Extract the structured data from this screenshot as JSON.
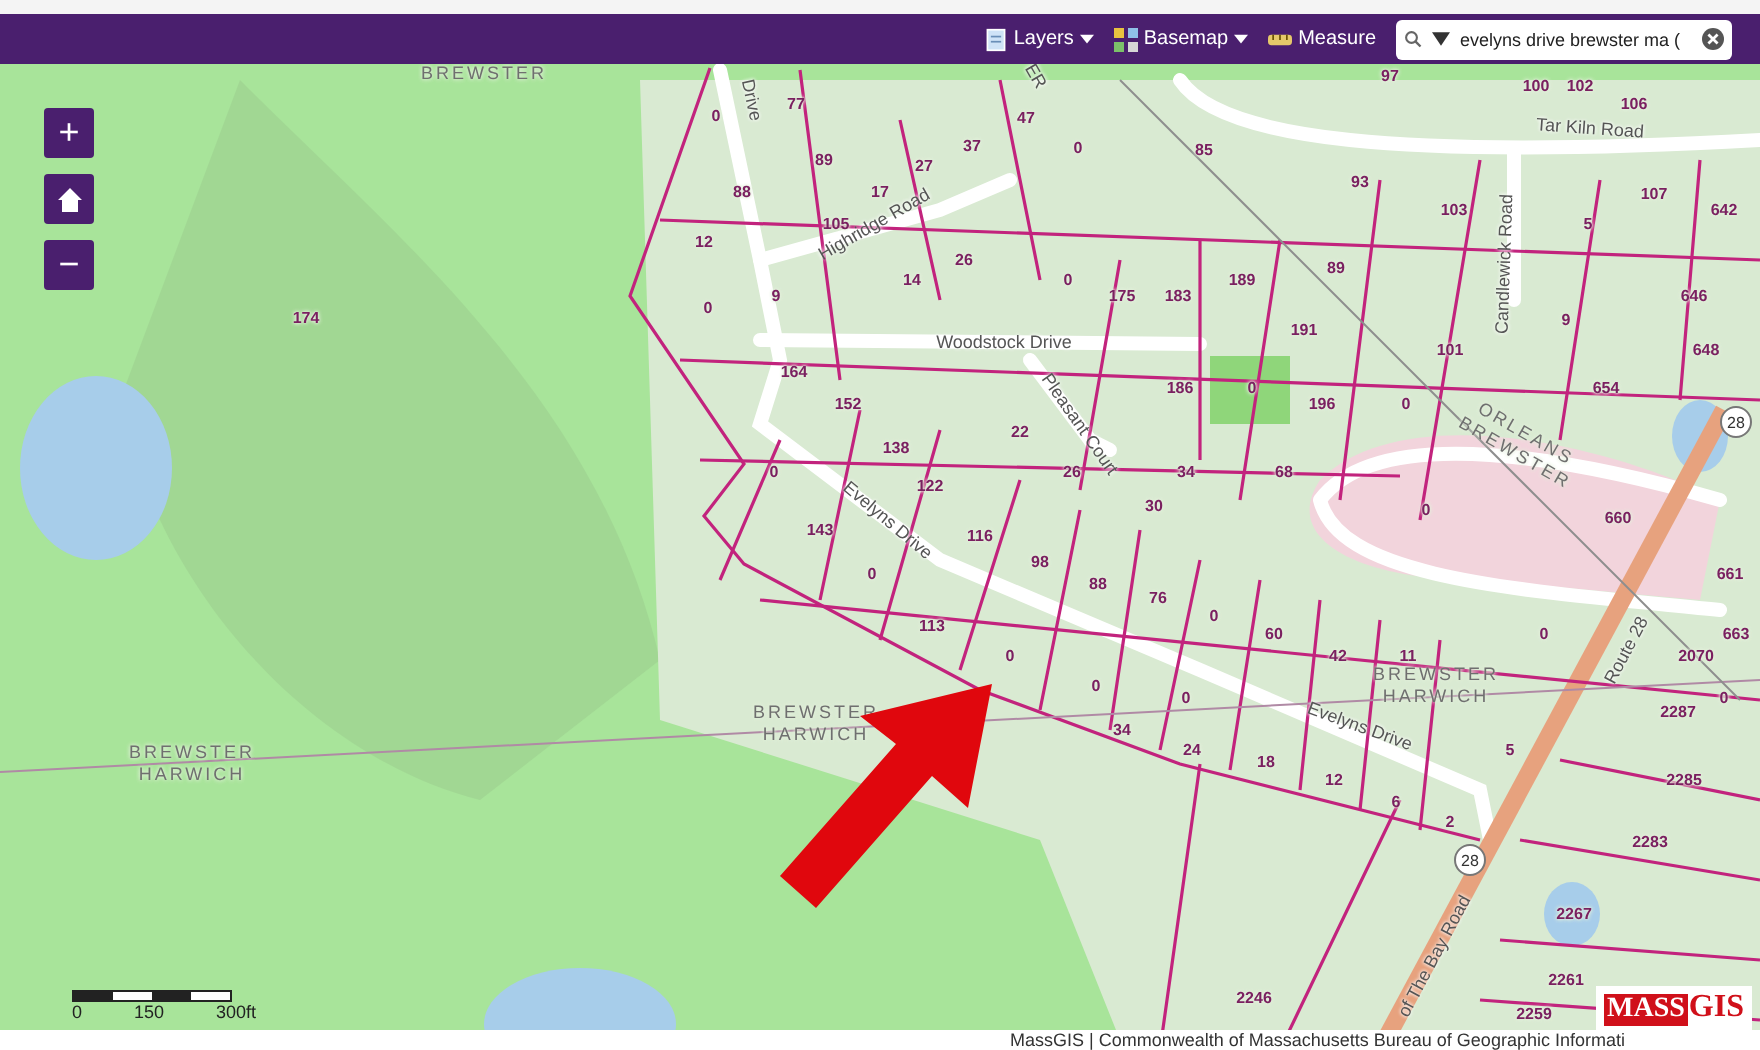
{
  "toolbar": {
    "items": [
      {
        "label": "Layers",
        "kind": "layers"
      },
      {
        "label": "Basemap",
        "kind": "basemap"
      },
      {
        "label": "Measure",
        "kind": "measure"
      }
    ],
    "search": {
      "value": "evelyns drive brewster ma ("
    }
  },
  "map": {
    "zoom_controls": [
      {
        "label": "+",
        "kind": "zoom-in"
      },
      {
        "kind": "home"
      },
      {
        "label": "−",
        "kind": "zoom-out"
      }
    ],
    "town_labels": [
      [
        "BREWSTER"
      ],
      [
        "ORLEANS",
        "BREWSTER"
      ],
      [
        "BREWSTER",
        "HARWICH"
      ],
      [
        "BREWSTER",
        "HARWICH"
      ],
      [
        "BREWSTER",
        "HARWICH"
      ]
    ],
    "road_labels": [
      "Drive",
      "ER",
      "Tar Kiln Road",
      "Highridge Road",
      "Candlewick Road",
      "Woodstock Drive",
      "Pleasant Court",
      "Evelyns Drive",
      "Evelyns Drive",
      "Route 28",
      "of The Bay Road"
    ],
    "route_shields": [
      "28",
      "28"
    ],
    "parcel_labels": [
      "97",
      "100",
      "102",
      "77",
      "106",
      "0",
      "47",
      "37",
      "0",
      "85",
      "89",
      "27",
      "93",
      "88",
      "17",
      "107",
      "103",
      "642",
      "105",
      "5",
      "12",
      "26",
      "89",
      "14",
      "0",
      "189",
      "9",
      "175",
      "183",
      "646",
      "0",
      "174",
      "9",
      "191",
      "101",
      "648",
      "164",
      "186",
      "0",
      "654",
      "152",
      "196",
      "0",
      "22",
      "138",
      "0",
      "26",
      "34",
      "68",
      "122",
      "30",
      "0",
      "660",
      "143",
      "116",
      "98",
      "0",
      "661",
      "88",
      "76",
      "0",
      "113",
      "60",
      "0",
      "663",
      "0",
      "42",
      "11",
      "2070",
      "0",
      "0",
      "0",
      "2287",
      "34",
      "24",
      "5",
      "18",
      "12",
      "2285",
      "6",
      "2",
      "2283",
      "2267",
      "2261",
      "2246",
      "2259"
    ],
    "scale": [
      "0",
      "150",
      "300ft"
    ],
    "logo": [
      "MASS",
      "GIS"
    ],
    "attribution": "MassGIS | Commonwealth of Massachusetts Bureau of Geographic Informati"
  }
}
